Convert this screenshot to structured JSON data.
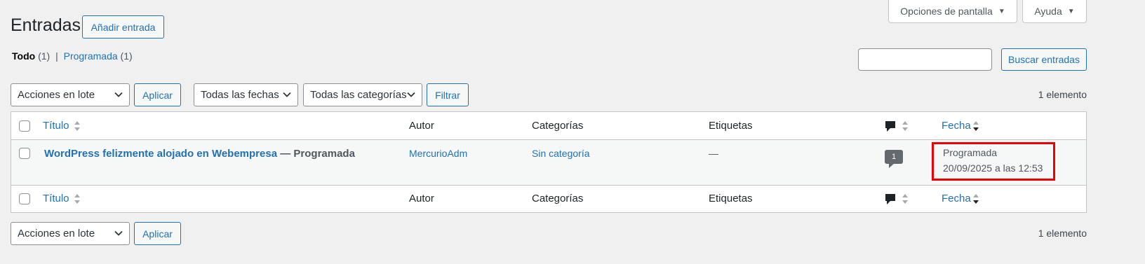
{
  "screen_options": {
    "label": "Opciones de pantalla",
    "arrow": "▼"
  },
  "help": {
    "label": "Ayuda",
    "arrow": "▼"
  },
  "page_title": "Entradas",
  "add_new_label": "Añadir entrada",
  "views": {
    "all_label": "Todo",
    "all_count": "(1)",
    "separator": "|",
    "scheduled_label": "Programada",
    "scheduled_count": "(1)"
  },
  "search": {
    "value": "",
    "button_label": "Buscar entradas"
  },
  "top_nav": {
    "bulk_actions": "Acciones en lote",
    "apply_label": "Aplicar",
    "dates_filter": "Todas las fechas",
    "categories_filter": "Todas las categorías",
    "filter_label": "Filtrar",
    "item_count": "1 elemento"
  },
  "table": {
    "columns": {
      "title": "Título",
      "author": "Autor",
      "categories": "Categorías",
      "tags": "Etiquetas",
      "date": "Fecha"
    },
    "rows": [
      {
        "title": "WordPress felizmente alojado en Webempresa",
        "state": " — Programada",
        "author": "MercurioAdm",
        "category": "Sin categoría",
        "tags": "—",
        "comments": "1",
        "date_status": "Programada",
        "date_value": "20/09/2025 a las 12:53"
      }
    ]
  },
  "bottom_nav": {
    "bulk_actions": "Acciones en lote",
    "apply_label": "Aplicar",
    "item_count": "1 elemento"
  },
  "colors": {
    "accent": "#2271b1",
    "highlight": "#ee0000"
  }
}
